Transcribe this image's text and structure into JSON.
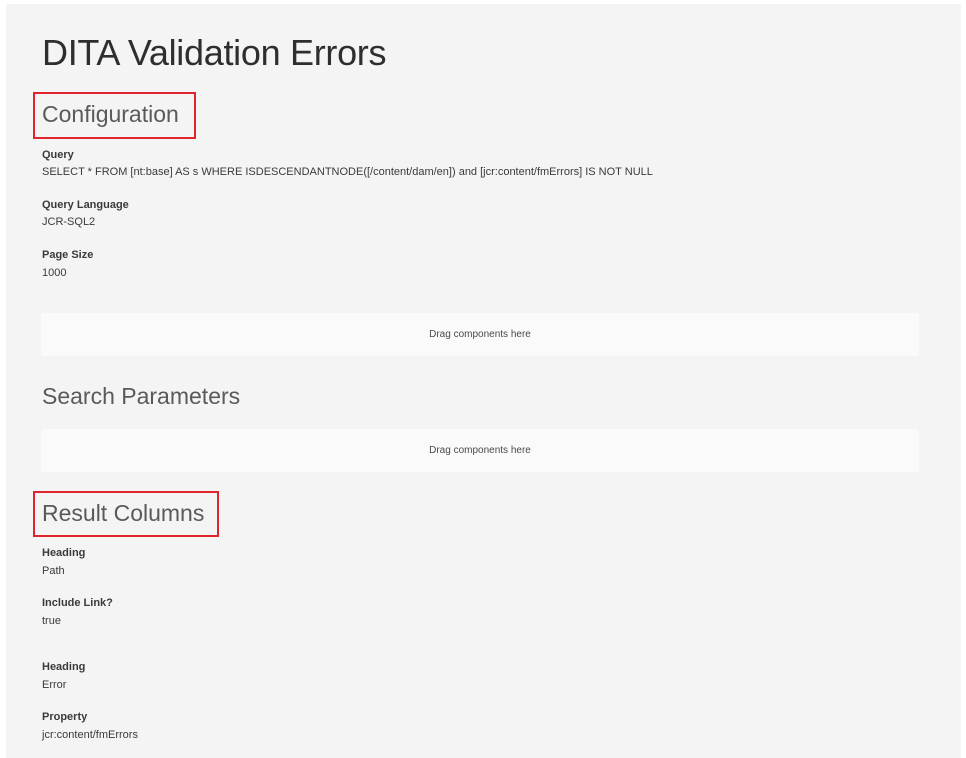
{
  "page": {
    "title": "DITA Validation Errors"
  },
  "configuration": {
    "heading": "Configuration",
    "fields": [
      {
        "label": "Query",
        "value": "SELECT * FROM [nt:base] AS s WHERE ISDESCENDANTNODE([/content/dam/en]) and [jcr:content/fmErrors] IS NOT NULL"
      },
      {
        "label": "Query Language",
        "value": "JCR-SQL2"
      },
      {
        "label": "Page Size",
        "value": "1000"
      }
    ],
    "dropzone_label": "Drag components here"
  },
  "search_parameters": {
    "heading": "Search Parameters",
    "dropzone_label": "Drag components here"
  },
  "result_columns": {
    "heading": "Result Columns",
    "columns": [
      {
        "fields": [
          {
            "label": "Heading",
            "value": "Path"
          },
          {
            "label": "Include Link?",
            "value": "true"
          }
        ]
      },
      {
        "fields": [
          {
            "label": "Heading",
            "value": "Error"
          },
          {
            "label": "Property",
            "value": "jcr:content/fmErrors"
          }
        ]
      }
    ]
  },
  "colors": {
    "highlight": "#e0262c",
    "background": "#f4f4f4",
    "dropzone": "#fafafa"
  }
}
